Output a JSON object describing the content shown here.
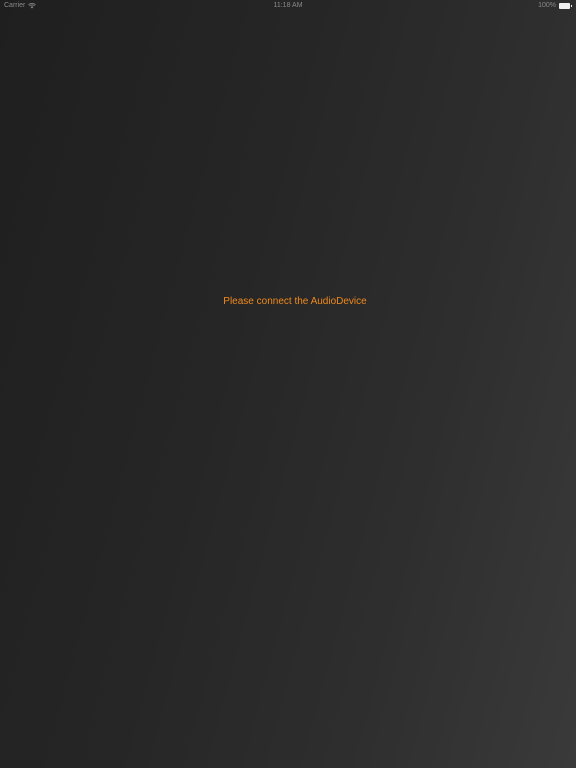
{
  "status_bar": {
    "carrier": "Carrier",
    "time": "11:18 AM",
    "battery": "100%"
  },
  "main": {
    "message": "Please connect the AudioDevice"
  },
  "colors": {
    "accent": "#f08a1c"
  }
}
